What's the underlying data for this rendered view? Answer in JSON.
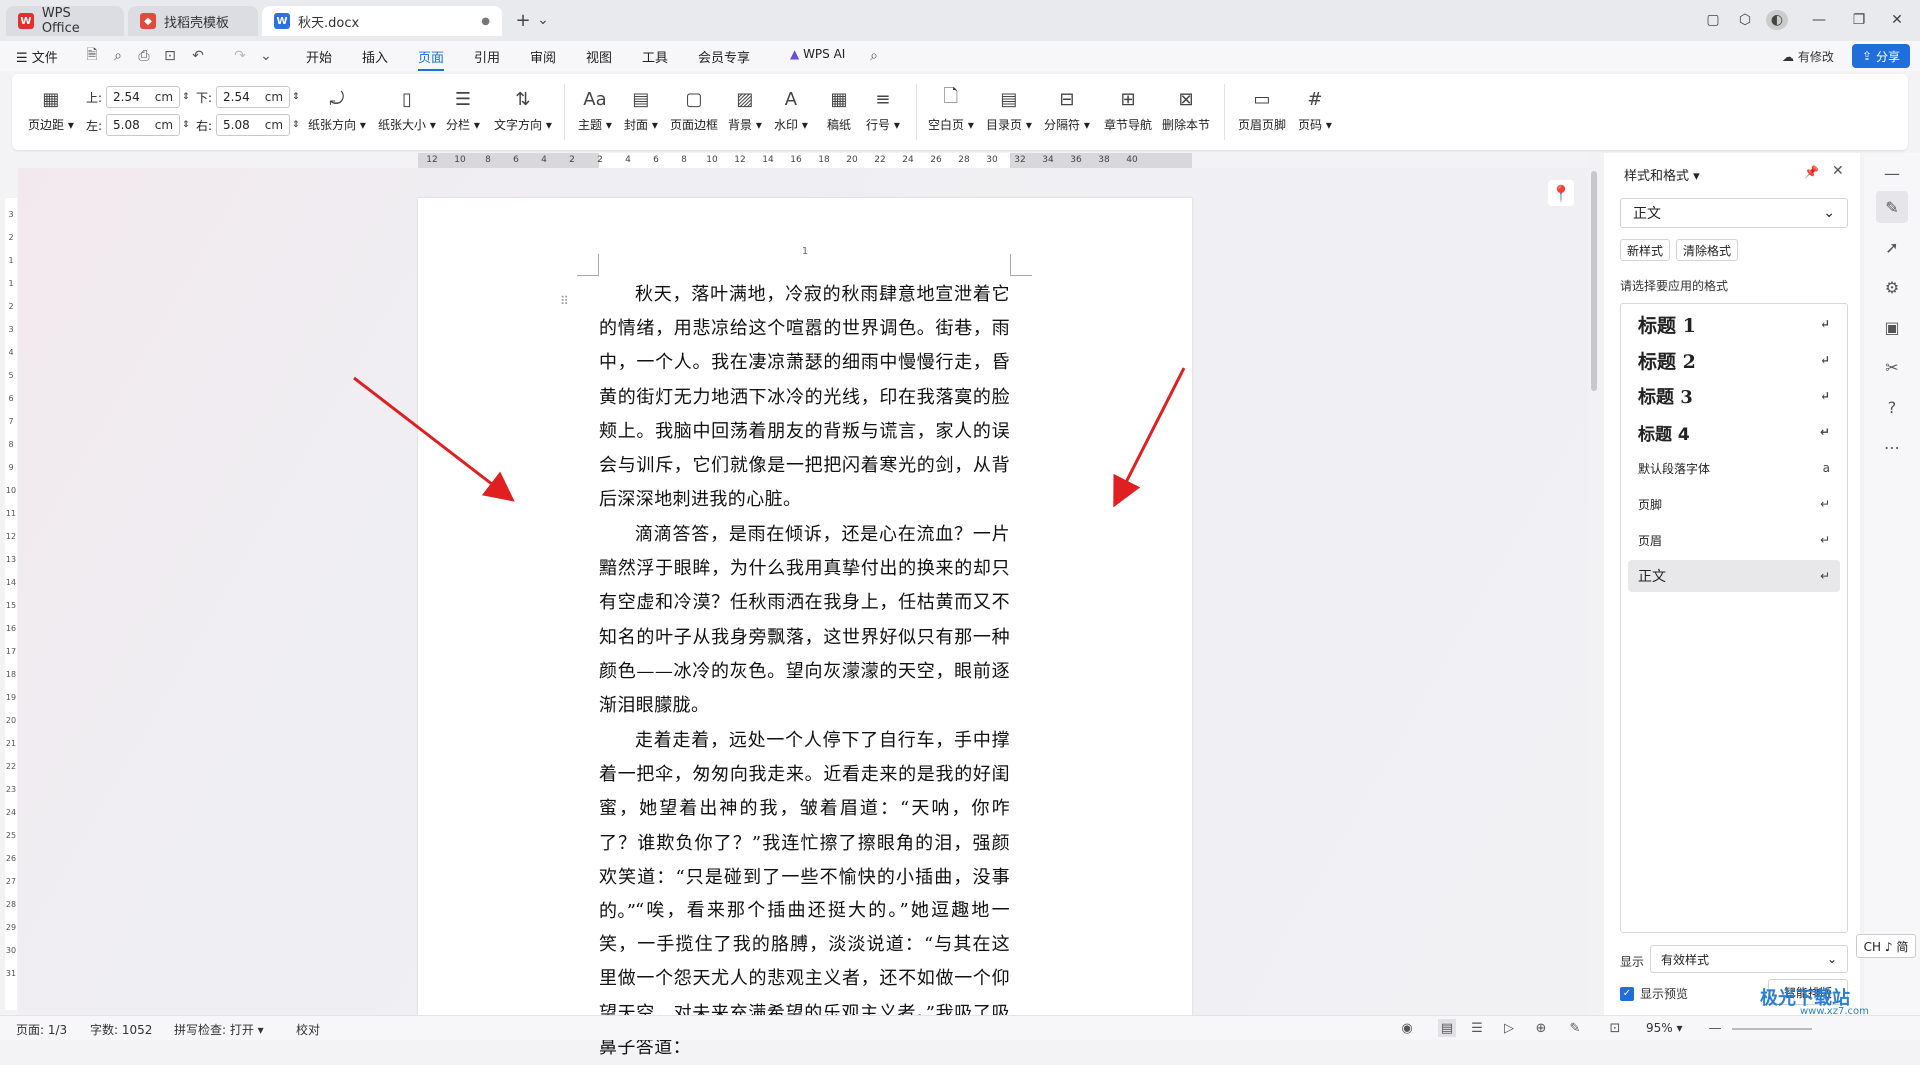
{
  "titlebar": {
    "tabs": [
      {
        "label": "WPS Office"
      },
      {
        "label": "找稻壳模板"
      },
      {
        "label": "秋天.docx"
      }
    ],
    "new_tab": "+",
    "tab_dropdown": "⌄"
  },
  "menu": {
    "file": "文件",
    "items": [
      "开始",
      "插入",
      "页面",
      "引用",
      "审阅",
      "视图",
      "工具",
      "会员专享"
    ],
    "active": "页面",
    "wps_ai": "WPS AI",
    "modified": "有修改",
    "share": "分享"
  },
  "ribbon": {
    "margins_label": "页边距",
    "top_label": "上:",
    "top_value": "2.54",
    "bottom_label": "下:",
    "bottom_value": "2.54",
    "left_label": "左:",
    "left_value": "5.08",
    "right_label": "右:",
    "right_value": "5.08",
    "unit": "cm",
    "buttons": [
      "纸张方向",
      "纸张大小",
      "分栏",
      "文字方向",
      "主题",
      "封面",
      "页面边框",
      "背景",
      "水印",
      "稿纸",
      "行号",
      "空白页",
      "目录页",
      "分隔符",
      "章节导航",
      "删除本节",
      "页眉页脚",
      "页码"
    ]
  },
  "ruler": {
    "h_numbers": [
      "12",
      "10",
      "8",
      "6",
      "4",
      "2",
      "2",
      "4",
      "6",
      "8",
      "10",
      "12",
      "14",
      "16",
      "18",
      "20",
      "22",
      "24",
      "26",
      "28",
      "30",
      "32",
      "34",
      "36",
      "38",
      "40"
    ],
    "v_numbers": [
      "3",
      "2",
      "1",
      "1",
      "2",
      "3",
      "4",
      "5",
      "6",
      "7",
      "8",
      "9",
      "10",
      "11",
      "12",
      "13",
      "14",
      "15",
      "16",
      "17",
      "18",
      "19",
      "20",
      "21",
      "22",
      "23",
      "24",
      "25",
      "26",
      "27",
      "28",
      "29",
      "30",
      "31"
    ]
  },
  "document": {
    "page_number": "1",
    "paragraphs": [
      "秋天，落叶满地，冷寂的秋雨肆意地宣泄着它的情绪，用悲凉给这个喧嚣的世界调色。街巷，雨中，一个人。我在凄凉萧瑟的细雨中慢慢行走，昏黄的街灯无力地洒下冰冷的光线，印在我落寞的脸颊上。我脑中回荡着朋友的背叛与谎言，家人的误会与训斥，它们就像是一把把闪着寒光的剑，从背后深深地刺进我的心脏。",
      "滴滴答答，是雨在倾诉，还是心在流血？一片黯然浮于眼眸，为什么我用真挚付出的换来的却只有空虚和冷漠？任秋雨洒在我身上，任枯黄而又不知名的叶子从我身旁飘落，这世界好似只有那一种颜色——冰冷的灰色。望向灰濛濛的天空，眼前逐渐泪眼朦胧。",
      "走着走着，远处一个人停下了自行车，手中撑着一把伞，匆匆向我走来。近看走来的是我的好闺蜜，她望着出神的我，皱着眉道：“天呐，你咋了？谁欺负你了？”我连忙擦了擦眼角的泪，强颜欢笑道：“只是碰到了一些不愉快的小插曲，没事的。”",
      "“唉，看来那个插曲还挺大的。”她逗趣地一笑，一手揽住了我的胳膊，淡淡说道：“与其在这里做一个怨天尤人的悲观主义者，还不如做一个仰望天空，对未来充满希望的乐观主义者。”我吸了吸鼻子答道："
    ]
  },
  "panel": {
    "title": "样式和格式",
    "current_style": "正文",
    "new_style": "新样式",
    "clear_format": "清除格式",
    "apply_label": "请选择要应用的格式",
    "styles": [
      {
        "name": "标题 1",
        "mark": "↵"
      },
      {
        "name": "标题 2",
        "mark": "↵"
      },
      {
        "name": "标题 3",
        "mark": "↵"
      },
      {
        "name": "标题 4",
        "mark": "↵"
      },
      {
        "name": "默认段落字体",
        "mark": "a"
      },
      {
        "name": "页脚",
        "mark": "↵"
      },
      {
        "name": "页眉",
        "mark": "↵"
      },
      {
        "name": "正文",
        "mark": "↵"
      }
    ],
    "show_label": "显示",
    "show_value": "有效样式",
    "preview_label": "显示预览",
    "smart_button": "智能排版"
  },
  "ime": "CH ♪ 简",
  "status": {
    "page": "页面: 1/3",
    "words": "字数: 1052",
    "spell": "拼写检查: 打开",
    "proof": "校对",
    "zoom": "95%"
  },
  "watermark": {
    "line1": "极光下载站",
    "line2": "www.xz7.com"
  },
  "colors": {
    "accent": "#1e6fdb",
    "arrow": "#e02020"
  }
}
